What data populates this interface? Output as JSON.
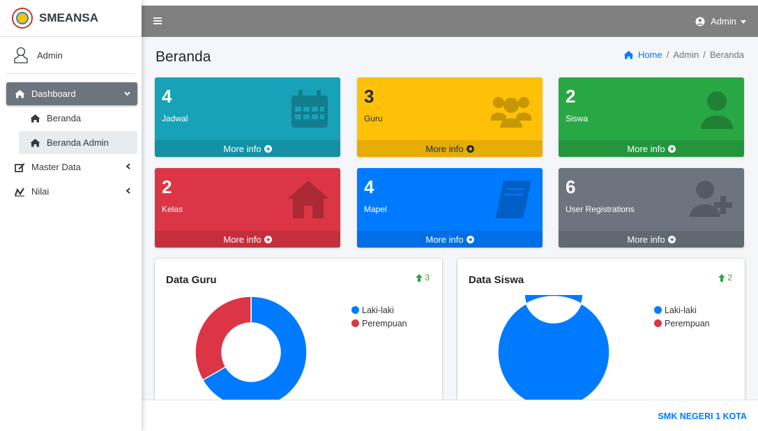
{
  "brand": {
    "name": "SMEANSA"
  },
  "user": {
    "name": "Admin"
  },
  "sidebar": {
    "items": [
      {
        "label": "Dashboard",
        "icon": "home-icon"
      },
      {
        "label": "Beranda",
        "icon": "home-icon"
      },
      {
        "label": "Beranda Admin",
        "icon": "home-icon"
      },
      {
        "label": "Master Data",
        "icon": "edit-icon"
      },
      {
        "label": "Nilai",
        "icon": "signature-icon"
      }
    ]
  },
  "topbar": {
    "user_label": "Admin"
  },
  "page": {
    "title": "Beranda"
  },
  "breadcrumb": [
    "Home",
    "Admin",
    "Beranda"
  ],
  "boxes": [
    {
      "value": "4",
      "label": "Jadwal",
      "footer": "More info",
      "color": "#17a2b8",
      "icon": "calendar-icon"
    },
    {
      "value": "3",
      "label": "Guru",
      "footer": "More info",
      "color": "#ffc107",
      "icon": "users-icon"
    },
    {
      "value": "2",
      "label": "Siswa",
      "footer": "More info",
      "color": "#28a745",
      "icon": "user-icon"
    },
    {
      "value": "2",
      "label": "Kelas",
      "footer": "More info",
      "color": "#dc3545",
      "icon": "house-icon"
    },
    {
      "value": "4",
      "label": "Mapel",
      "footer": "More info",
      "color": "#007bff",
      "icon": "book-icon"
    },
    {
      "value": "6",
      "label": "User Registrations",
      "footer": "More info",
      "color": "#6c757d",
      "icon": "user-plus-icon"
    }
  ],
  "cards": [
    {
      "title": "Data Guru",
      "badge": "3"
    },
    {
      "title": "Data Siswa",
      "badge": "2"
    }
  ],
  "chart_data": [
    {
      "type": "pie",
      "title": "Data Guru",
      "categories": [
        "Laki-laki",
        "Perempuan"
      ],
      "values": [
        2,
        1
      ],
      "colors": [
        "#007bff",
        "#dc3545"
      ],
      "legend": "top-right"
    },
    {
      "type": "pie",
      "title": "Data Siswa",
      "categories": [
        "Laki-laki",
        "Perempuan"
      ],
      "values": [
        2,
        0
      ],
      "colors": [
        "#007bff",
        "#dc3545"
      ],
      "legend": "top-right"
    }
  ],
  "footer": {
    "text": "SMK NEGERI 1 KOTA"
  }
}
